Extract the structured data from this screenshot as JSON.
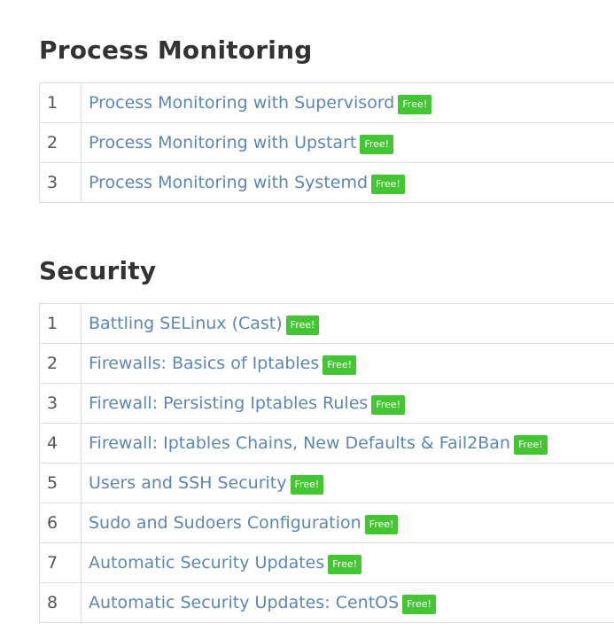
{
  "sections": [
    {
      "title": "Process Monitoring",
      "lessons": [
        {
          "number": "1",
          "title": "Process Monitoring with Supervisord",
          "badge": "Free!"
        },
        {
          "number": "2",
          "title": "Process Monitoring with Upstart",
          "badge": "Free!"
        },
        {
          "number": "3",
          "title": "Process Monitoring with Systemd",
          "badge": "Free!"
        }
      ]
    },
    {
      "title": "Security",
      "lessons": [
        {
          "number": "1",
          "title": "Battling SELinux (Cast)",
          "badge": "Free!"
        },
        {
          "number": "2",
          "title": "Firewalls: Basics of Iptables",
          "badge": "Free!"
        },
        {
          "number": "3",
          "title": "Firewall: Persisting Iptables Rules",
          "badge": "Free!"
        },
        {
          "number": "4",
          "title": "Firewall: Iptables Chains, New Defaults & Fail2Ban",
          "badge": "Free!"
        },
        {
          "number": "5",
          "title": "Users and SSH Security",
          "badge": "Free!"
        },
        {
          "number": "6",
          "title": "Sudo and Sudoers Configuration",
          "badge": "Free!"
        },
        {
          "number": "7",
          "title": "Automatic Security Updates",
          "badge": "Free!"
        },
        {
          "number": "8",
          "title": "Automatic Security Updates: CentOS",
          "badge": "Free!"
        }
      ]
    }
  ],
  "colors": {
    "link": "#5d87b3",
    "badge": "#44c534",
    "heading": "#333333",
    "border": "#dddddd"
  }
}
